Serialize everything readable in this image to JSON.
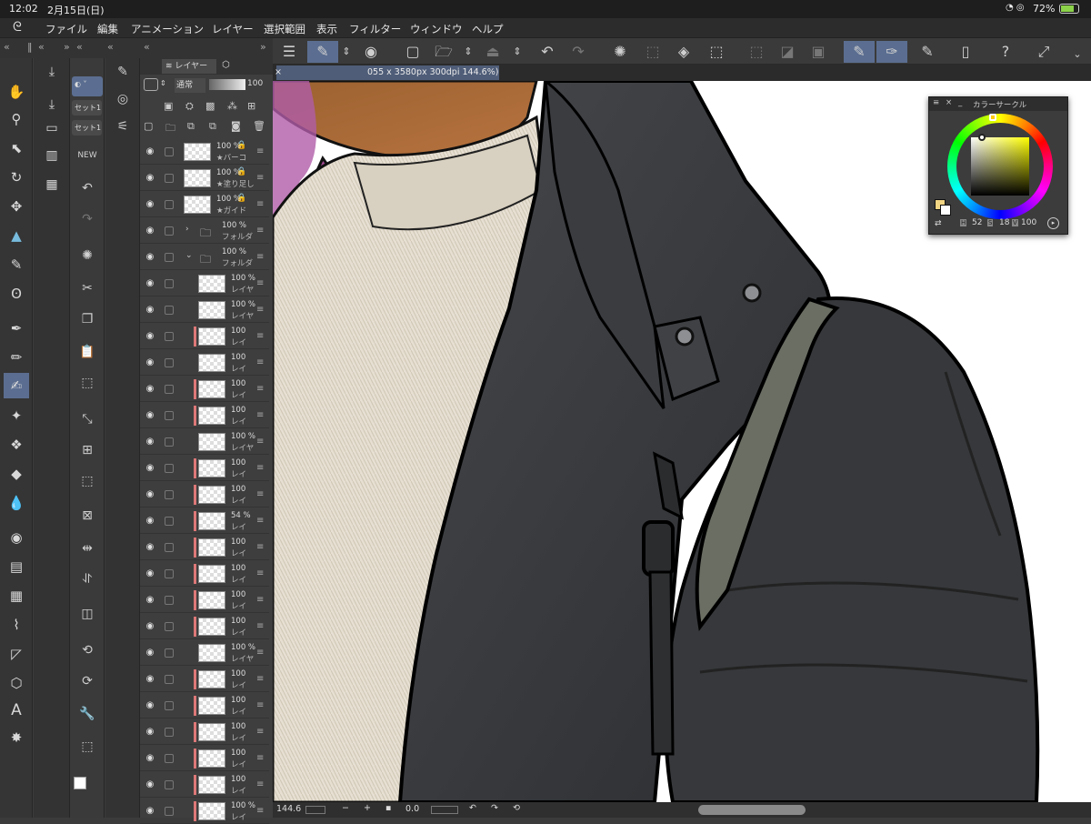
{
  "status": {
    "time": "12:02",
    "date": "2月15日(日)",
    "battery": "72%"
  },
  "menu": [
    "ファイル",
    "編集",
    "アニメーション",
    "レイヤー",
    "選択範囲",
    "表示",
    "フィルター",
    "ウィンドウ",
    "ヘルプ"
  ],
  "canvas_tab": {
    "info": "055 x 3580px 300dpi 144.6%)"
  },
  "layer_panel": {
    "tab_label": "レイヤー",
    "blend_mode": "通常",
    "opacity": "100",
    "layers": [
      {
        "opacity": "100 %",
        "name": "★バーコ",
        "type": "layer",
        "locked": true
      },
      {
        "opacity": "100 %",
        "name": "★塗り足し",
        "type": "layer",
        "locked": true
      },
      {
        "opacity": "100 %",
        "name": "★ガイド",
        "type": "layer",
        "locked": true
      },
      {
        "opacity": "100 %",
        "name": "フォルダ",
        "type": "folder-closed"
      },
      {
        "opacity": "100 %",
        "name": "フォルダ",
        "type": "folder-open"
      },
      {
        "opacity": "100 %",
        "name": "レイヤ",
        "type": "layer"
      },
      {
        "opacity": "100 %",
        "name": "レイヤ",
        "type": "layer"
      },
      {
        "opacity": "100",
        "name": "レイ",
        "type": "layer",
        "red": true
      },
      {
        "opacity": "100",
        "name": "レイ",
        "type": "layer"
      },
      {
        "opacity": "100",
        "name": "レイ",
        "type": "layer",
        "red": true
      },
      {
        "opacity": "100",
        "name": "レイ",
        "type": "layer",
        "red": true
      },
      {
        "opacity": "100 %",
        "name": "レイヤ",
        "type": "layer"
      },
      {
        "opacity": "100",
        "name": "レイ",
        "type": "layer",
        "red": true
      },
      {
        "opacity": "100",
        "name": "レイ",
        "type": "layer",
        "red": true
      },
      {
        "opacity": "54 %",
        "name": "レイ",
        "type": "layer",
        "red": true
      },
      {
        "opacity": "100",
        "name": "レイ",
        "type": "layer",
        "red": true
      },
      {
        "opacity": "100",
        "name": "レイ",
        "type": "layer",
        "red": true
      },
      {
        "opacity": "100",
        "name": "レイ",
        "type": "layer",
        "red": true
      },
      {
        "opacity": "100",
        "name": "レイ",
        "type": "layer",
        "red": true
      },
      {
        "opacity": "100 %",
        "name": "レイヤ",
        "type": "layer"
      },
      {
        "opacity": "100",
        "name": "レイ",
        "type": "layer",
        "red": true
      },
      {
        "opacity": "100",
        "name": "レイ",
        "type": "layer",
        "red": true
      },
      {
        "opacity": "100",
        "name": "レイ",
        "type": "layer",
        "red": true
      },
      {
        "opacity": "100",
        "name": "レイ",
        "type": "layer",
        "red": true
      },
      {
        "opacity": "100",
        "name": "レイ",
        "type": "layer",
        "red": true
      },
      {
        "opacity": "100 %",
        "name": "レイ",
        "type": "layer",
        "red": true
      }
    ]
  },
  "subtools": {
    "pill1": "セット1",
    "pill2": "セット1"
  },
  "color_panel": {
    "title": "カラーサークル",
    "h_label": "H",
    "h": "52",
    "s_label": "S",
    "s": "18",
    "v_label": "V",
    "v": "100",
    "main_color": "#f3d684",
    "sub_color": "#ffffff"
  },
  "bottom": {
    "zoom": "144.6",
    "angle": "0.0"
  },
  "colors": {
    "accent": "#5b6e91",
    "panel": "#3e3e3e",
    "layer_red": "#dd7777"
  }
}
